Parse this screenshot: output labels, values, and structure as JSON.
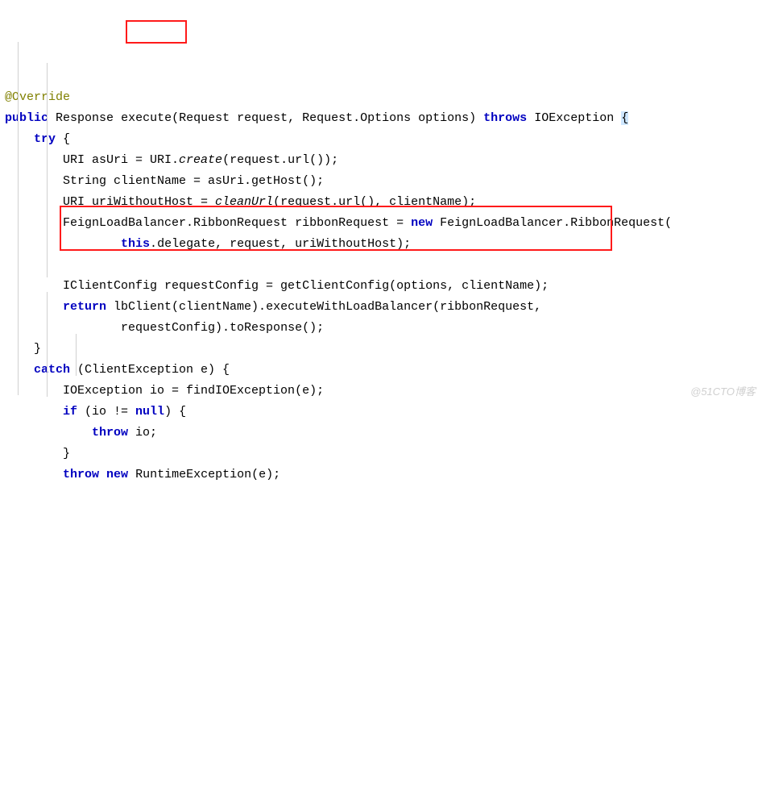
{
  "code": {
    "annotation": "@Override",
    "kw_public": "public",
    "type_response": "Response",
    "method_name": "execute",
    "params": "(Request request, Request.Options options)",
    "kw_throws": "throws",
    "exc_io": "IOException",
    "open_brace": "{",
    "kw_try": "try",
    "line_try_open": " {",
    "l1a": "URI asUri = URI.",
    "l1b": "create",
    "l1c": "(request.url());",
    "l2": "String clientName = asUri.getHost();",
    "l3a": "URI uriWithoutHost = ",
    "l3b": "cleanUrl",
    "l3c": "(request.url(), clientName);",
    "l4a": "FeignLoadBalancer.RibbonRequest ribbonRequest = ",
    "kw_new": "new",
    "l4b": " FeignLoadBalancer.RibbonRequest(",
    "kw_this": "this",
    "l5a": ".",
    "l5b": "delegate",
    "l5c": ", request, uriWithoutHost);",
    "l6": "IClientConfig requestConfig = getClientConfig(options, clientName);",
    "kw_return": "return",
    "l7a": " lbClient(clientName).executeWithLoadBalancer(ribbonRequest,",
    "l7b": "requestConfig).toResponse();",
    "close_brace": "}",
    "kw_catch": "catch",
    "catch_param": " (ClientException e) {",
    "l8": "IOException io = findIOException(e);",
    "kw_if": "if",
    "if_cond": " (io != ",
    "kw_null": "null",
    "if_end": ") {",
    "kw_throw": "throw",
    "throw_io": " io;",
    "kw_throw2": "throw",
    "kw_new2": "new",
    "throw_rt": " RuntimeException(e);"
  },
  "watermark": "@51CTO博客"
}
